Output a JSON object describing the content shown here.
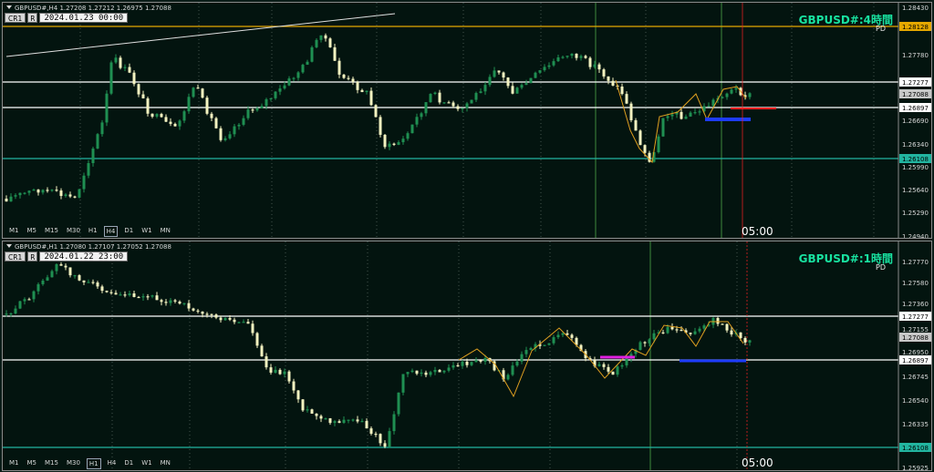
{
  "colors": {
    "up": "#1f8f52",
    "down": "#f3f2c0",
    "background": "#03140f",
    "accent": "#18e2a0"
  },
  "panes": [
    {
      "header": "GBPUSD#,H4  1.27208 1.27212 1.26975 1.27088",
      "toolbar": {
        "cr": "CR1",
        "r": "R",
        "date": "2024.01.23 00:00"
      },
      "title": "GBPUSD#:4時間",
      "pd": "PD",
      "timeframes": [
        "M1",
        "M5",
        "M15",
        "M30",
        "H1",
        "H4",
        "D1",
        "W1",
        "MN"
      ],
      "selected_tf": "H4",
      "time_label": "05:00",
      "axis": [
        "1.28430",
        "1.28128",
        "1.27780",
        "1.27277",
        "1.27088",
        "1.26897",
        "1.26690",
        "1.26340",
        "1.26108",
        "1.25990",
        "1.25640",
        "1.25290",
        "1.24940"
      ],
      "axis_boxes": {
        "gold": "1.28128",
        "white": "1.27277",
        "gray": "1.27088",
        "white2": "1.26897",
        "teal": "1.26108"
      },
      "icons": [
        "collapse-triangle-icon"
      ]
    },
    {
      "header": "GBPUSD#,H1  1.27080 1.27107 1.27052 1.27088",
      "toolbar": {
        "cr": "CR1",
        "r": "R",
        "date": "2024.01.22 23:00"
      },
      "title": "GBPUSD#:1時間",
      "pd": "PD",
      "timeframes": [
        "M1",
        "M5",
        "M15",
        "M30",
        "H1",
        "H4",
        "D1",
        "W1",
        "MN"
      ],
      "selected_tf": "H1",
      "time_label": "05:00",
      "axis": [
        "1.27770",
        "1.27580",
        "1.27360",
        "1.27277",
        "1.27155",
        "1.27088",
        "1.26950",
        "1.26897",
        "1.26745",
        "1.26540",
        "1.26335",
        "1.26108",
        "1.25925"
      ],
      "axis_boxes": {
        "white": "1.27277",
        "gray": "1.27088",
        "white2": "1.26897",
        "teal": "1.26108"
      },
      "icons": [
        "collapse-triangle-icon"
      ]
    }
  ]
}
